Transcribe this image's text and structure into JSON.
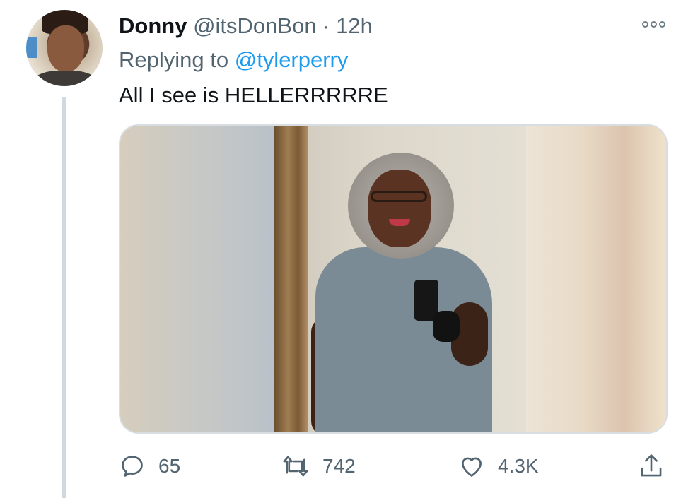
{
  "tweet": {
    "display_name": "Donny",
    "handle": "@itsDonBon",
    "separator": "·",
    "time": "12h",
    "replying_prefix": "Replying to",
    "replying_to": "@tylerperry",
    "text": "All I see is HELLERRRRRE"
  },
  "actions": {
    "reply_count": "65",
    "retweet_count": "742",
    "like_count": "4.3K"
  },
  "icons": {
    "more": "more-icon",
    "reply": "reply-icon",
    "retweet": "retweet-icon",
    "like": "heart-icon",
    "share": "share-icon"
  },
  "colors": {
    "text": "#0f1419",
    "secondary": "#536471",
    "link": "#1d9bf0",
    "thread_line": "#cfd9de"
  }
}
